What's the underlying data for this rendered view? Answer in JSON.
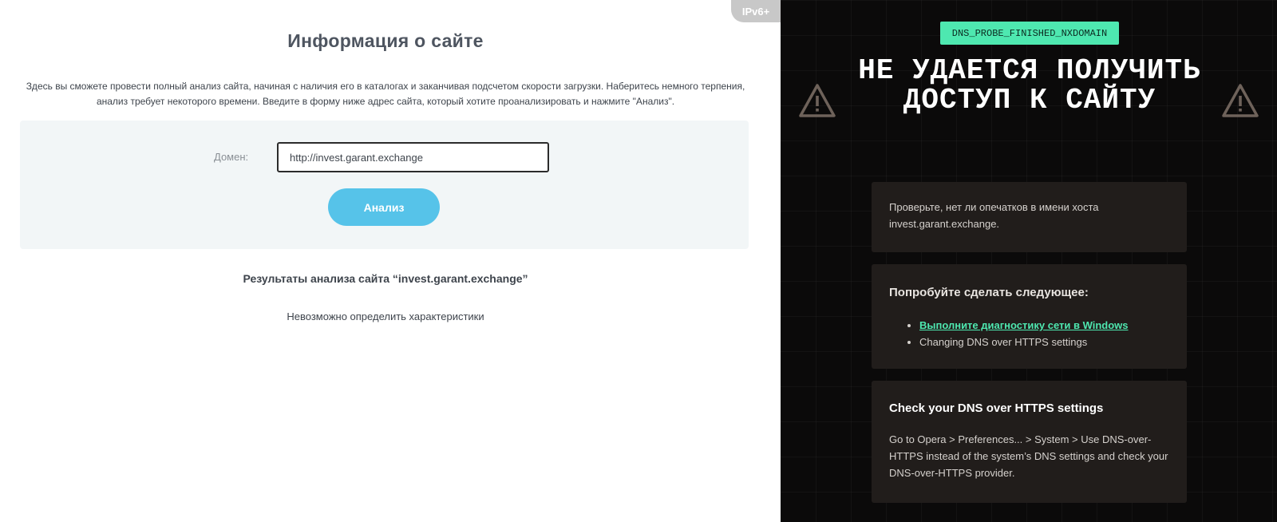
{
  "left": {
    "badge": "IPv6+",
    "title": "Информация о сайте",
    "description": "Здесь вы сможете провести полный анализ сайта, начиная с наличия его в каталогах и заканчивая подсчетом скорости загрузки. Наберитесь немного терпения, анализ требует некоторого времени. Введите в форму ниже адрес сайта, который хотите проанализировать и нажмите \"Анализ\".",
    "form": {
      "domain_label": "Домен:",
      "domain_value": "http://invest.garant.exchange",
      "submit_label": "Анализ"
    },
    "results_title": "Результаты анализа сайта “invest.garant.exchange”",
    "results_text": "Невозможно определить характеристики"
  },
  "right": {
    "error_code": "DNS_PROBE_FINISHED_NXDOMAIN",
    "error_title": "НЕ УДАЕТСЯ ПОЛУЧИТЬ ДОСТУП К САЙТУ",
    "card1_text": "Проверьте, нет ли опечатков в имени хоста invest.garant.exchange.",
    "card2_heading": "Попробуйте сделать следующее:",
    "card2_items": [
      "Выполните диагностику сети в Windows",
      "Changing DNS over HTTPS settings"
    ],
    "card3_heading": "Check your DNS over HTTPS settings",
    "card3_text": "Go to Opera > Preferences... > System > Use DNS-over-HTTPS instead of the system’s DNS settings and check your DNS-over-HTTPS provider.",
    "icons": [
      "warning-icon",
      "warning-icon"
    ],
    "colors": {
      "accent": "#4ee8b0",
      "background": "#0b0a0a",
      "card": "#211d1b"
    }
  }
}
